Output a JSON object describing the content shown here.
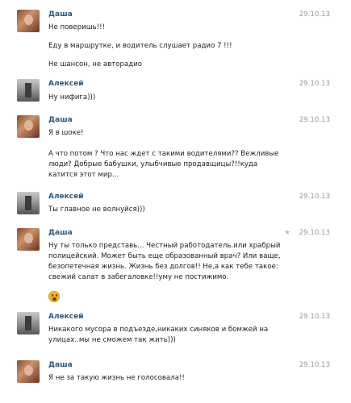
{
  "messages": [
    {
      "author": "Даша",
      "date": "29.10.13",
      "avatar": "dasha-avatar",
      "lines": [
        "Не поверишь!!!",
        "",
        "Еду в маршрутке, и водитель слушает радио 7 !!!",
        "",
        "Не шансон, не авторадио"
      ]
    },
    {
      "author": "Алексей",
      "date": "29.10.13",
      "avatar": "aleksey-avatar",
      "lines": [
        "Ну нифига)))"
      ]
    },
    {
      "author": "Даша",
      "date": "29.10.13",
      "avatar": "dasha-avatar",
      "lines": [
        "Я в шоке!",
        "",
        "А что потом ? Что нас ждет с такими водителями?? Вежливые",
        "люди? Добрые бабушки, улыбчивые продавщицы?!!куда",
        "катится этот мир..."
      ]
    },
    {
      "author": "Алексей",
      "date": "29.10.13",
      "avatar": "aleksey-avatar",
      "lines": [
        "Ты главное не волнуйся)))"
      ]
    },
    {
      "author": "Даша",
      "date": "29.10.13",
      "avatar": "dasha-avatar",
      "starred": true,
      "star_icon": "star-icon",
      "lines": [
        "Ну ты только представь... Честный работодатель.или храбрый",
        "полицейский. Может быть еще образованный врач? Или ваще,",
        "безопетечная жизнь. Жизнь без долгов!! Не,а как тебе такое:",
        "свежий салат в забегаловке!!уму не постижимо."
      ],
      "emoji": "surprised-face-emoji"
    },
    {
      "author": "Алексей",
      "date": "29.10.13",
      "avatar": "aleksey-avatar",
      "lines": [
        "Никакого мусора в подъезде,никаких синяков и бомжей на",
        "улицах..мы не сможем так жить)))"
      ]
    },
    {
      "author": "Даша",
      "date": "29.10.13",
      "avatar": "dasha-avatar",
      "lines": [
        "Я не за такую жизнь не голосовала!!"
      ]
    }
  ]
}
